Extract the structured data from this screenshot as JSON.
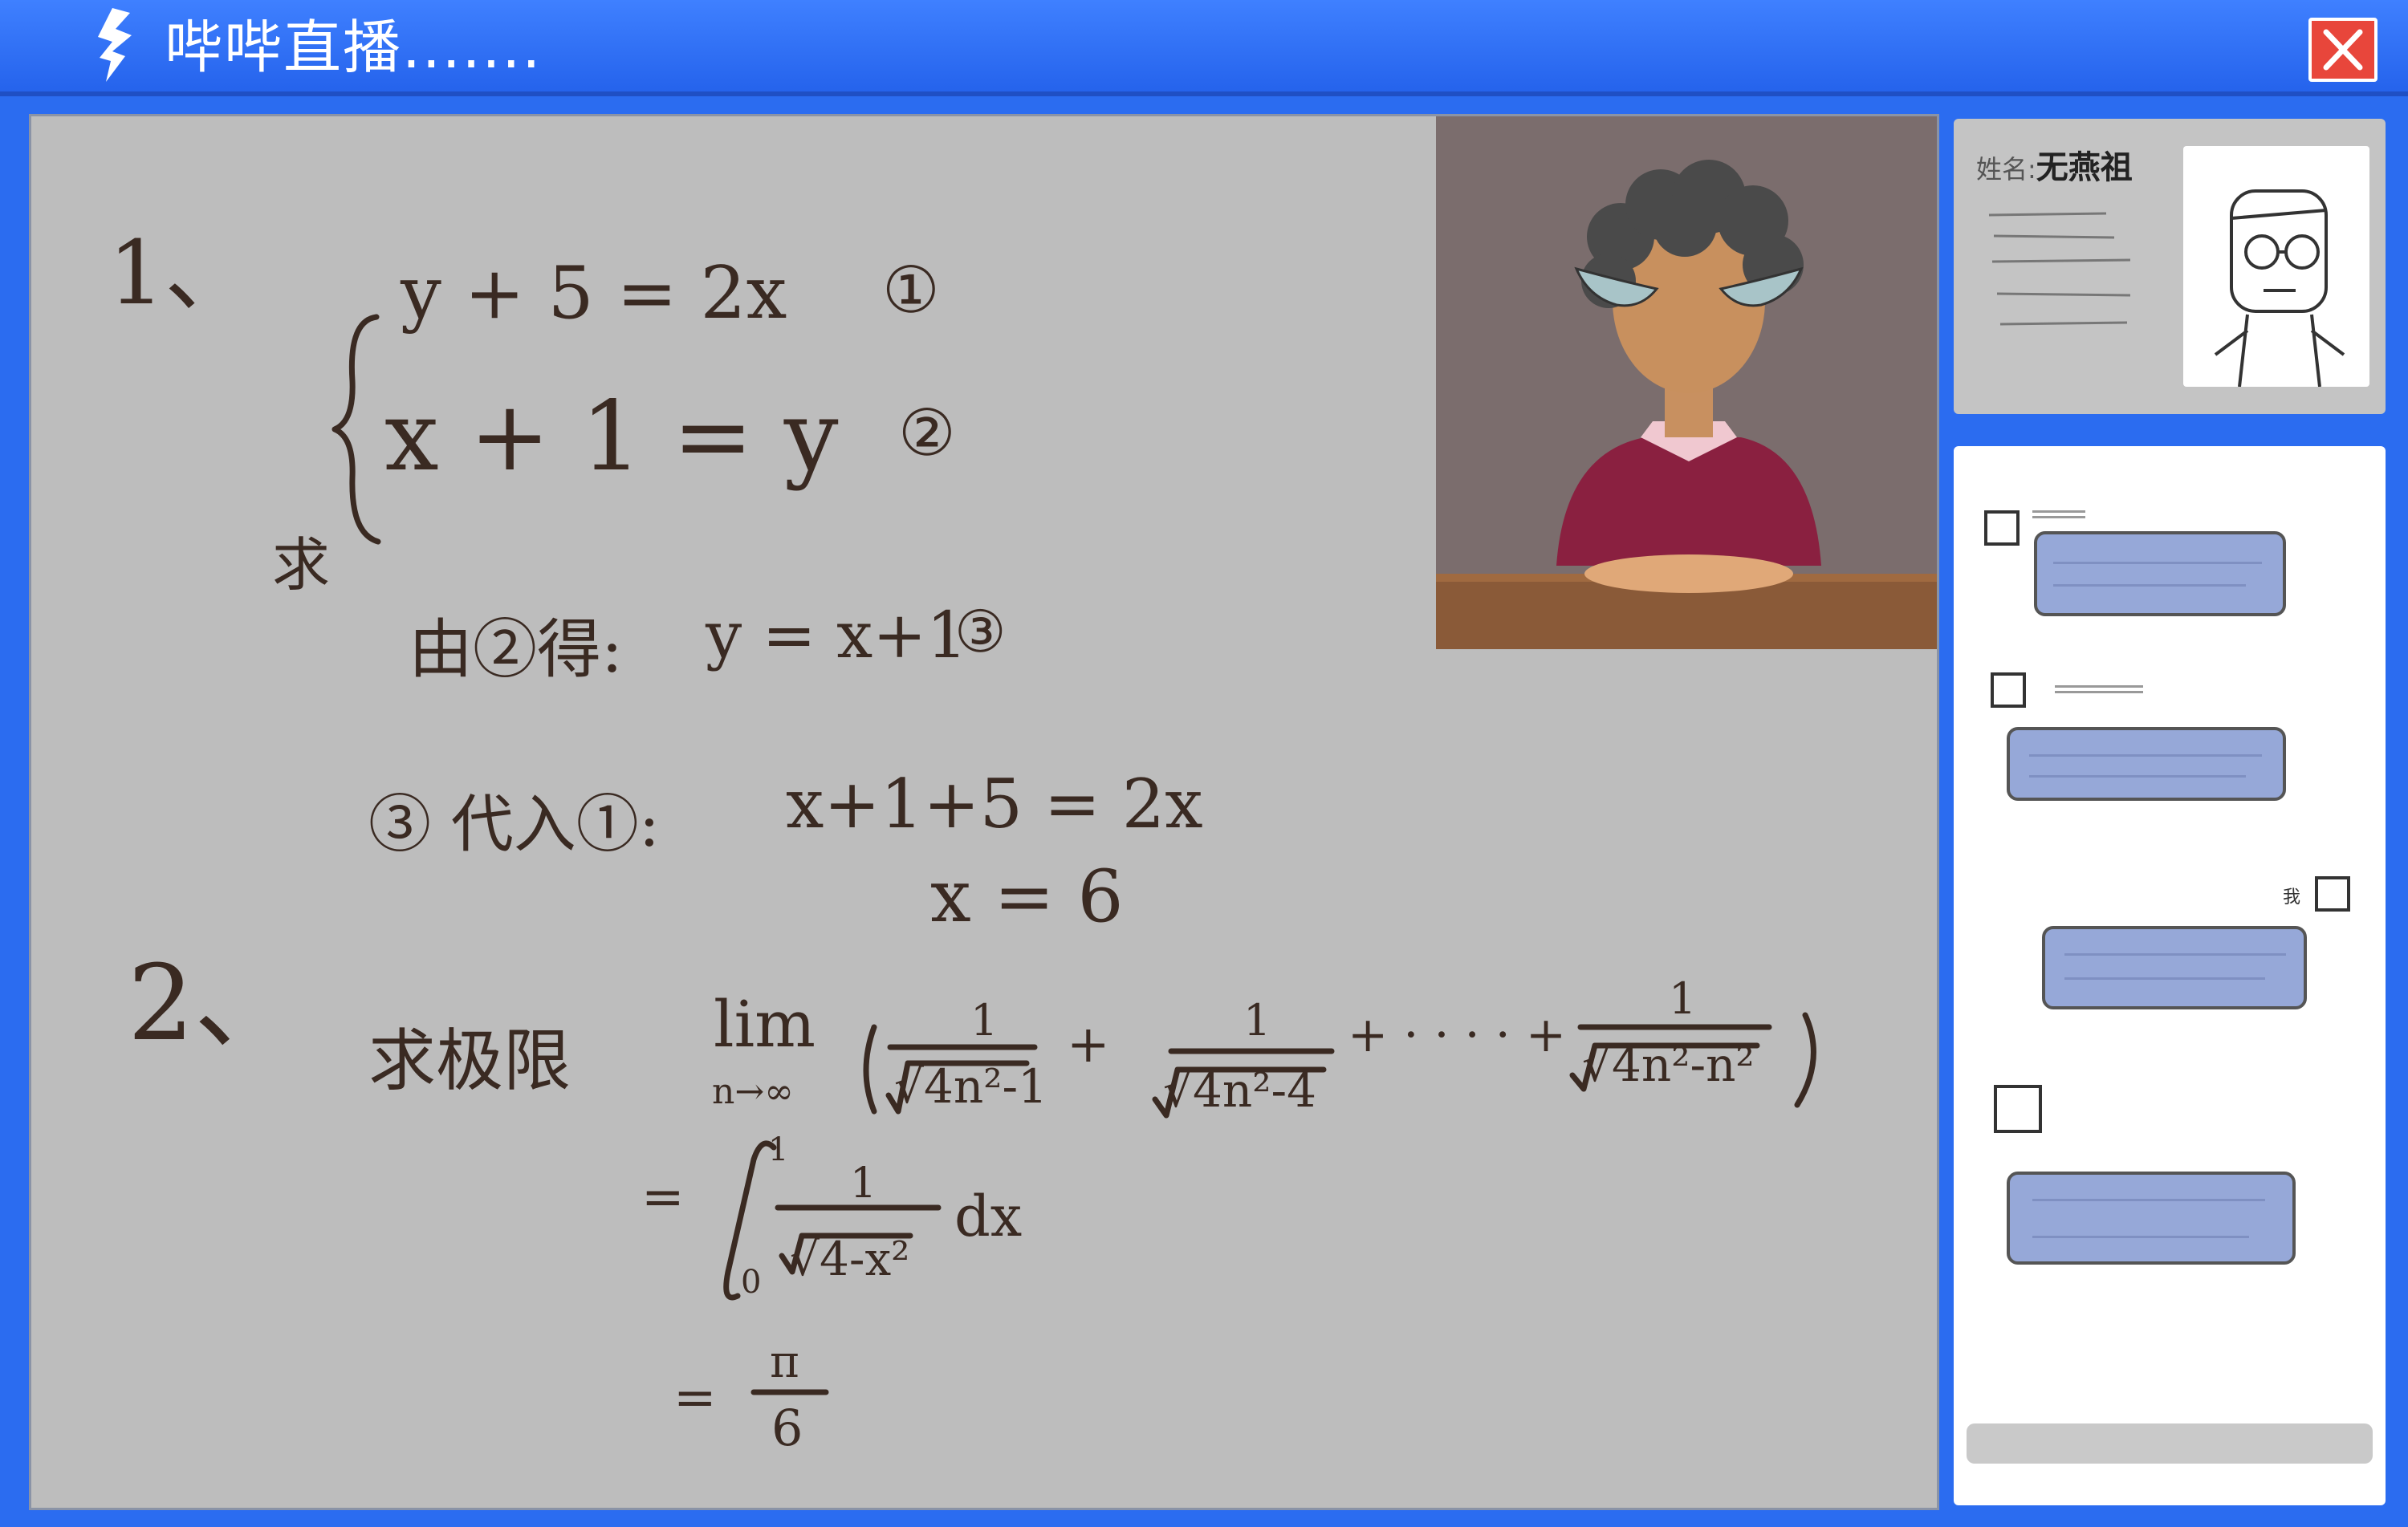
{
  "window": {
    "title": "哔哔直播.......",
    "logo_icon": "lightning-logo-icon",
    "close_icon": "close-icon",
    "accent": "#2b6cf0",
    "close_color": "#e8463b"
  },
  "board": {
    "background": "#bdbdbd",
    "ink_color": "#3a2a22",
    "q1": {
      "number": "1、",
      "eq1": "y + 5 = 2x",
      "eq1_tag": "①",
      "eq2": "x + 1 = y",
      "eq2_tag": "②",
      "solve": "求",
      "step1_label": "由②得:",
      "step1": "y = x+1",
      "step1_tag": "③",
      "step2_label": "③ 代入①:",
      "step2": "x+1+5 = 2x",
      "result": "x = 6"
    },
    "q2": {
      "number": "2、",
      "label": "求极限",
      "lim": "lim",
      "lim_sub": "n→∞",
      "t1_num": "1",
      "t1_den": "√4n²-1",
      "plus": "+",
      "t2_num": "1",
      "t2_den": "√4n²-4",
      "dots": "+ · · · · +",
      "t3_num": "1",
      "t3_den": "√4n²-n²",
      "eq": "=",
      "int_upper": "1",
      "int_lower": "0",
      "int_num": "1",
      "int_den": "√4-x²",
      "dx": "dx",
      "answer_num": "π",
      "answer_den": "6"
    }
  },
  "teacher_video": {
    "icon": "teacher-avatar-icon"
  },
  "profile": {
    "name_label": "姓名:",
    "name_value": "无燕祖",
    "avatar_icon": "student-avatar-icon"
  },
  "chat": {
    "messages": [
      {
        "side": "left",
        "avatar_icon": "user-avatar-icon"
      },
      {
        "side": "left",
        "avatar_icon": "user-avatar-icon"
      },
      {
        "side": "right",
        "sender": "我",
        "avatar_icon": "user-avatar-icon"
      },
      {
        "side": "left",
        "avatar_icon": "user-avatar-icon"
      }
    ],
    "input_placeholder": ""
  }
}
